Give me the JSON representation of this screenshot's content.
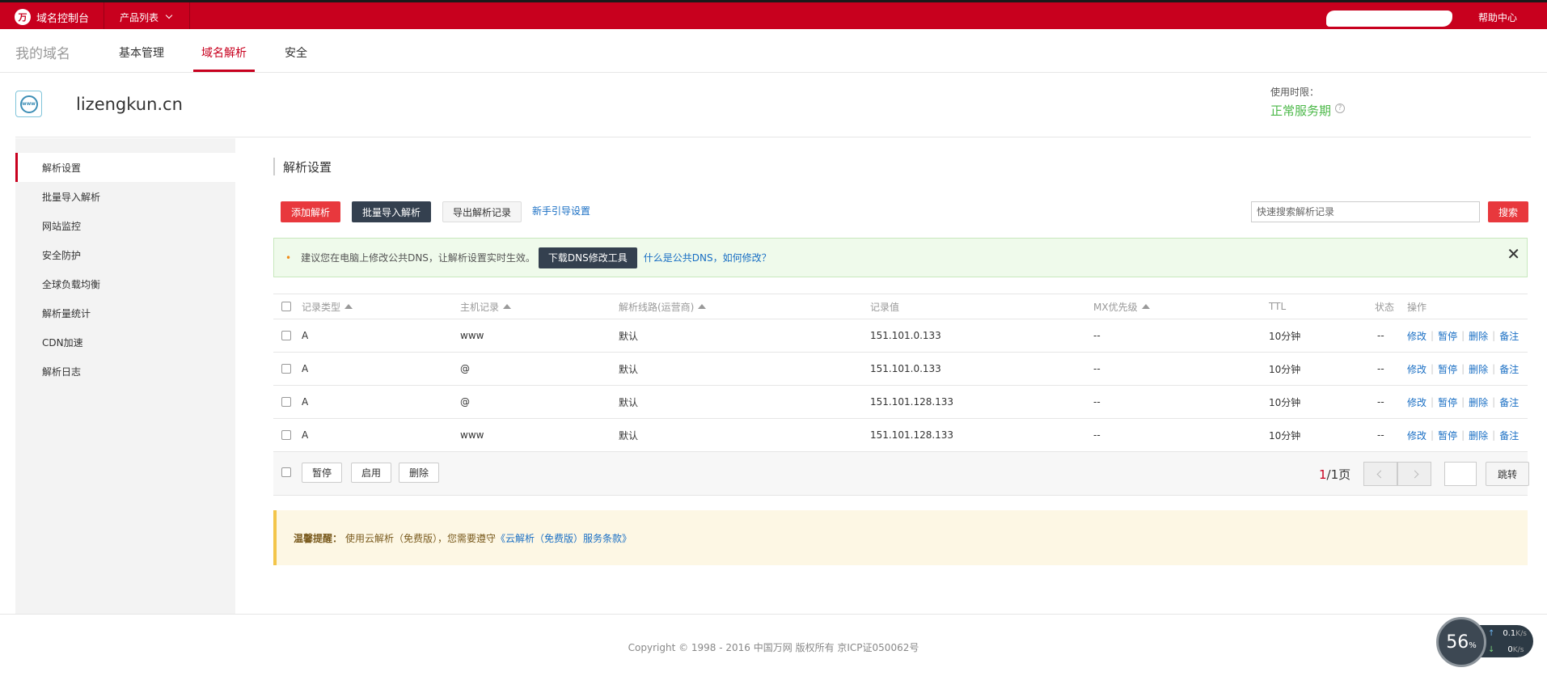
{
  "topbar": {
    "brand": "域名控制台",
    "product_menu": "产品列表",
    "help": "帮助中心"
  },
  "nav": {
    "title": "我的域名",
    "tabs": [
      "基本管理",
      "域名解析",
      "安全"
    ],
    "active_tab": "域名解析"
  },
  "domain": {
    "name": "lizengkun.cn",
    "period_label": "使用时限：",
    "period_status": "正常服务期"
  },
  "sidebar": {
    "items": [
      "解析设置",
      "批量导入解析",
      "网站监控",
      "安全防护",
      "全球负载均衡",
      "解析量统计",
      "CDN加速",
      "解析日志"
    ],
    "active": "解析设置"
  },
  "main": {
    "title": "解析设置",
    "toolbar": {
      "add": "添加解析",
      "batch_import": "批量导入解析",
      "export": "导出解析记录",
      "guide": "新手引导设置"
    },
    "search": {
      "placeholder": "快速搜索解析记录",
      "button": "搜索"
    },
    "notice": {
      "text": "建议您在电脑上修改公共DNS，让解析设置实时生效。",
      "download_btn": "下载DNS修改工具",
      "link": "什么是公共DNS，如何修改？"
    }
  },
  "table": {
    "headers": [
      "记录类型",
      "主机记录",
      "解析线路(运营商)",
      "记录值",
      "MX优先级",
      "TTL",
      "状态",
      "操作"
    ],
    "rows": [
      {
        "type": "A",
        "host": "www",
        "line": "默认",
        "value": "151.101.0.133",
        "mx": "--",
        "ttl": "10分钟",
        "status": "--"
      },
      {
        "type": "A",
        "host": "@",
        "line": "默认",
        "value": "151.101.0.133",
        "mx": "--",
        "ttl": "10分钟",
        "status": "--"
      },
      {
        "type": "A",
        "host": "@",
        "line": "默认",
        "value": "151.101.128.133",
        "mx": "--",
        "ttl": "10分钟",
        "status": "--"
      },
      {
        "type": "A",
        "host": "www",
        "line": "默认",
        "value": "151.101.128.133",
        "mx": "--",
        "ttl": "10分钟",
        "status": "--"
      }
    ],
    "ops": {
      "edit": "修改",
      "pause": "暂停",
      "delete": "删除",
      "note": "备注"
    }
  },
  "table_footer": {
    "pause": "暂停",
    "enable": "启用",
    "delete": "删除",
    "page_current": "1",
    "page_total": "/1页",
    "jump": "跳转"
  },
  "tip": {
    "label": "温馨提醒：",
    "text": "使用云解析（免费版），您需要遵守",
    "link": "《云解析（免费版）服务条款》"
  },
  "footer": {
    "copyright": "Copyright © 1998 - 2016 中国万网 版权所有 京ICP证050062号"
  },
  "speed_widget": {
    "percent": "56",
    "percent_unit": "%",
    "up": "0.1",
    "down": "0",
    "unit": "K/s"
  },
  "colors": {
    "brand_red": "#c8001e",
    "button_red": "#e8383d",
    "button_dark": "#34404f",
    "link_blue": "#1a6fc4",
    "status_green": "#4bb848"
  }
}
